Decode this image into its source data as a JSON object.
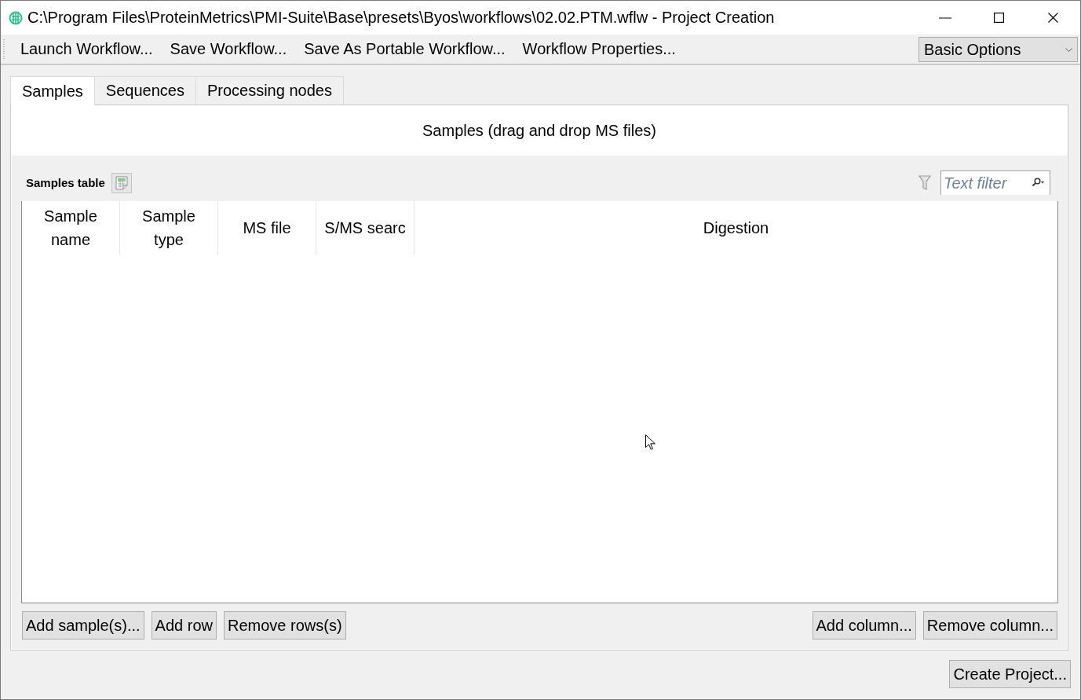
{
  "window": {
    "title": "C:\\Program Files\\ProteinMetrics\\PMI-Suite\\Base\\presets\\Byos\\workflows\\02.02.PTM.wflw - Project Creation"
  },
  "toolbar": {
    "items": [
      {
        "label": "Launch Workflow..."
      },
      {
        "label": "Save Workflow..."
      },
      {
        "label": "Save As Portable Workflow..."
      },
      {
        "label": "Workflow Properties..."
      }
    ],
    "options_dropdown": {
      "value": "Basic Options"
    }
  },
  "tabs": [
    {
      "label": "Samples",
      "selected": true
    },
    {
      "label": "Sequences",
      "selected": false
    },
    {
      "label": "Processing nodes",
      "selected": false
    }
  ],
  "samples_panel": {
    "drop_hint": "Samples (drag and drop MS files)",
    "table": {
      "title": "Samples table",
      "filter": {
        "placeholder": "Text filter"
      },
      "columns": [
        {
          "label": "Sample name"
        },
        {
          "label": "Sample type"
        },
        {
          "label": "MS file"
        },
        {
          "label": "S/MS searc"
        },
        {
          "label": "Digestion"
        }
      ]
    },
    "buttons_left": [
      "Add sample(s)...",
      "Add row",
      "Remove rows(s)"
    ],
    "buttons_right": [
      "Add column...",
      "Remove column..."
    ]
  },
  "footer": {
    "buttons": [
      "Create Project..."
    ]
  }
}
